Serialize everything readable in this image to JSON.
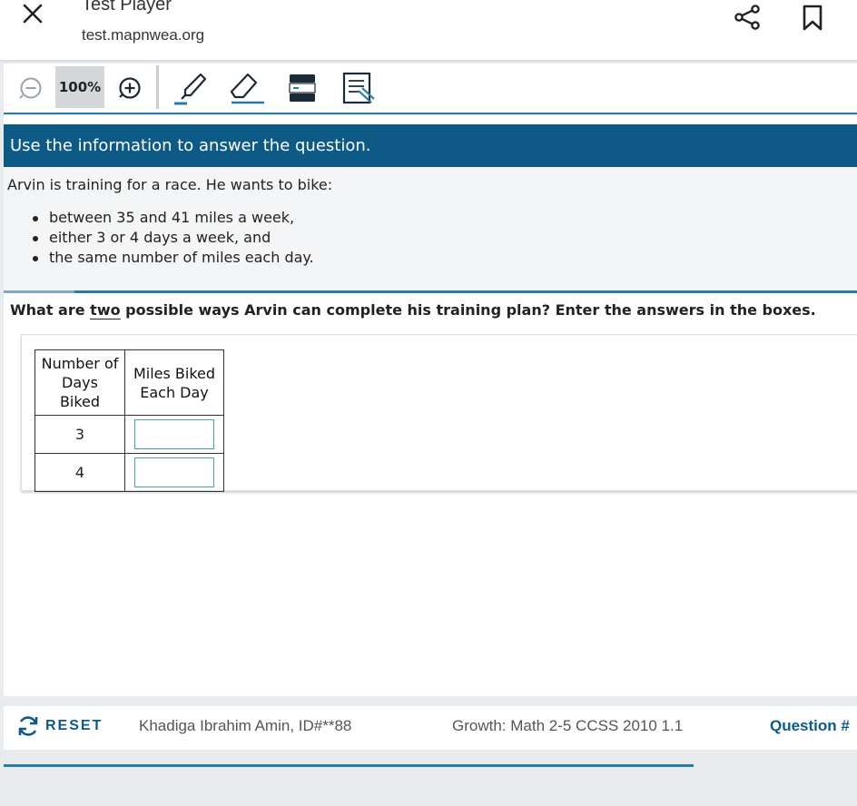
{
  "browser": {
    "title": "Test Player",
    "url": "test.mapnwea.org",
    "icons": [
      "close-icon",
      "share-icon",
      "bookmark-icon"
    ]
  },
  "toolbar": {
    "zoom_level": "100%",
    "icons": [
      "zoom-out-icon",
      "zoom-in-icon",
      "highlighter-icon",
      "eraser-icon",
      "line-reader-icon",
      "answer-eliminator-icon"
    ]
  },
  "stimulus": {
    "header": "Use the information to answer the question.",
    "intro": "Arvin is training for a race. He wants to bike:",
    "bullets": [
      "between 35 and 41 miles a week,",
      "either 3 or 4 days a week, and",
      "the same number of miles each day."
    ]
  },
  "question": {
    "prompt_before": "What are ",
    "prompt_emphasis": "two",
    "prompt_after": " possible ways Arvin can complete his training plan? Enter the answers in the boxes.",
    "table": {
      "col1_line1": "Number of",
      "col1_line2": "Days Biked",
      "col2_line1": "Miles Biked",
      "col2_line2": "Each Day",
      "rows": [
        {
          "days": "3",
          "miles": ""
        },
        {
          "days": "4",
          "miles": ""
        }
      ]
    }
  },
  "footer": {
    "reset_label": "RESET",
    "student": "Khadiga Ibrahim Amin, ID#**88",
    "test_name": "Growth: Math 2-5 CCSS 2010 1.1",
    "question_label": "Question #"
  },
  "colors": {
    "primary": "#0d5a87",
    "accent": "#2a7aa3",
    "input_border": "#4aa0a8",
    "background": "#e8ebee"
  }
}
